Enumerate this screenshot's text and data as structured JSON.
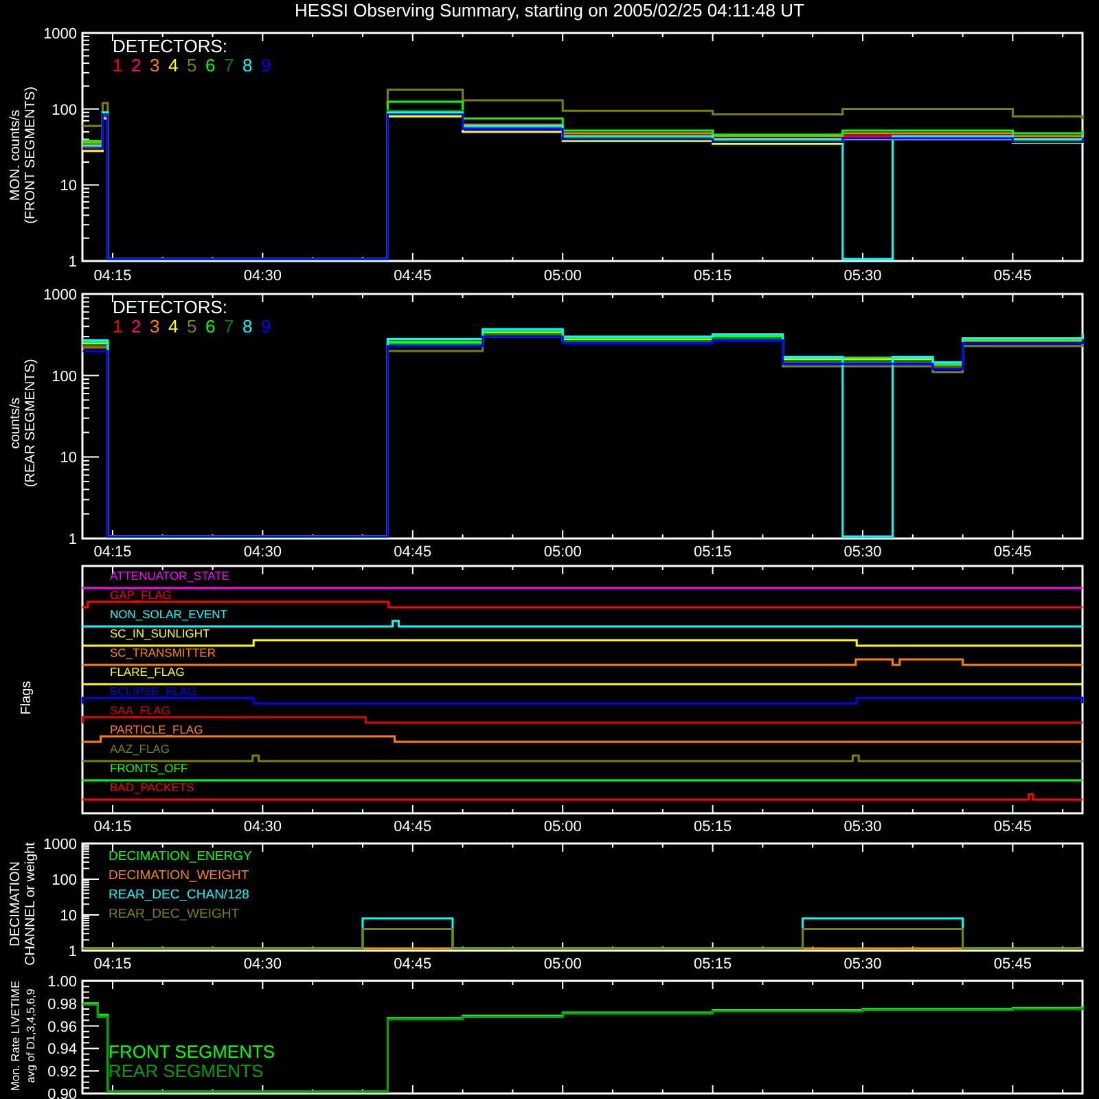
{
  "title": "HESSI Observing Summary, starting on 2005/02/25 04:11:48 UT",
  "panels": [
    {
      "kind": "counts",
      "ylabel": [
        "MON. counts/s",
        "(FRONT SEGMENTS)"
      ],
      "yticks": [
        "1000",
        "100",
        "10",
        "1"
      ],
      "time_labels": [
        "04:15",
        "04:30",
        "04:45",
        "05:00",
        "05:15",
        "05:30",
        "05:45"
      ],
      "legend_title": "DETECTORS:",
      "legend": [
        {
          "label": "1",
          "color": "#ff0000"
        },
        {
          "label": "2",
          "color": "#ff0080"
        },
        {
          "label": "3",
          "color": "#ff8000"
        },
        {
          "label": "4",
          "color": "#ffff00"
        },
        {
          "label": "5",
          "color": "#808000"
        },
        {
          "label": "6",
          "color": "#00ff00"
        },
        {
          "label": "7",
          "color": "#008000"
        },
        {
          "label": "8",
          "color": "#00ffff"
        },
        {
          "label": "9",
          "color": "#0000ff"
        }
      ]
    },
    {
      "kind": "counts",
      "ylabel": [
        "counts/s",
        "(REAR SEGMENTS)"
      ],
      "yticks": [
        "1000",
        "100",
        "10",
        "1"
      ],
      "time_labels": [
        "04:15",
        "04:30",
        "04:45",
        "05:00",
        "05:15",
        "05:30",
        "05:45"
      ],
      "legend_title": "DETECTORS:",
      "legend": [
        {
          "label": "1",
          "color": "#ff0000"
        },
        {
          "label": "2",
          "color": "#ff0080"
        },
        {
          "label": "3",
          "color": "#ff8000"
        },
        {
          "label": "4",
          "color": "#ffff00"
        },
        {
          "label": "5",
          "color": "#808000"
        },
        {
          "label": "6",
          "color": "#00ff00"
        },
        {
          "label": "7",
          "color": "#008000"
        },
        {
          "label": "8",
          "color": "#00ffff"
        },
        {
          "label": "9",
          "color": "#0000ff"
        }
      ]
    },
    {
      "kind": "flags",
      "ylabel": [
        "Flags"
      ],
      "time_labels": [
        "04:15",
        "04:30",
        "04:45",
        "05:00",
        "05:15",
        "05:30",
        "05:45"
      ],
      "flags": [
        {
          "label": "ATTENUATOR_STATE",
          "color": "#ff00ff"
        },
        {
          "label": "GAP_FLAG",
          "color": "#ff0000"
        },
        {
          "label": "NON_SOLAR_EVENT",
          "color": "#00ffff"
        },
        {
          "label": "SC_IN_SUNLIGHT",
          "color": "#ffff00"
        },
        {
          "label": "SC_TRANSMITTER",
          "color": "#ff8000"
        },
        {
          "label": "FLARE_FLAG",
          "color": "#fffe00"
        },
        {
          "label": "ECLIPSE_FLAG",
          "color": "#0000ff"
        },
        {
          "label": "SAA_FLAG",
          "color": "#e00000"
        },
        {
          "label": "PARTICLE_FLAG",
          "color": "#ff7f00"
        },
        {
          "label": "AAZ_FLAG",
          "color": "#808000"
        },
        {
          "label": "FRONTS_OFF",
          "color": "#00ff00"
        },
        {
          "label": "BAD_PACKETS",
          "color": "#fe0000"
        }
      ]
    },
    {
      "kind": "decimation",
      "ylabel": [
        "DECIMATION",
        "CHANNEL or weight"
      ],
      "yticks": [
        "1000",
        "100",
        "10",
        "1"
      ],
      "time_labels": [
        "04:15",
        "04:30",
        "04:45",
        "05:00",
        "05:15",
        "05:30",
        "05:45"
      ],
      "legend": [
        {
          "label": "DECIMATION_ENERGY",
          "color": "#00ff00"
        },
        {
          "label": "DECIMATION_WEIGHT",
          "color": "#ff8000"
        },
        {
          "label": "REAR_DEC_CHAN/128",
          "color": "#00ffff"
        },
        {
          "label": "REAR_DEC_WEIGHT",
          "color": "#808000"
        }
      ]
    },
    {
      "kind": "livetime",
      "ylabel": [
        "Mon. Rate LIVETIME",
        "avg of D1,3,4,5,6,9"
      ],
      "yticks": [
        "1.00",
        "0.98",
        "0.96",
        "0.94",
        "0.92",
        "0.90"
      ],
      "legend": [
        {
          "label": "FRONT SEGMENTS",
          "color": "#00ff00"
        },
        {
          "label": "REAR SEGMENTS",
          "color": "#00a000"
        }
      ]
    }
  ]
}
